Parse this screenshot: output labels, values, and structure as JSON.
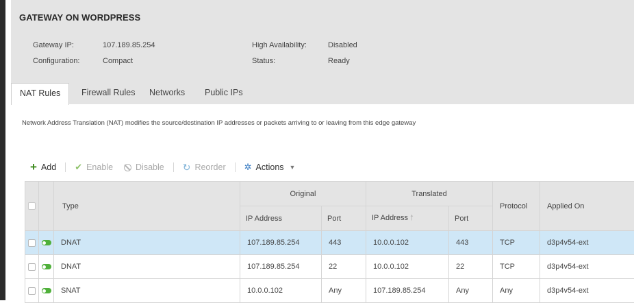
{
  "header": {
    "title": "GATEWAY ON WORDPRESS",
    "gateway_ip_label": "Gateway IP:",
    "gateway_ip_value": "107.189.85.254",
    "configuration_label": "Configuration:",
    "configuration_value": "Compact",
    "ha_label": "High Availability:",
    "ha_value": "Disabled",
    "status_label": "Status:",
    "status_value": "Ready"
  },
  "tabs": [
    {
      "label": "NAT Rules",
      "active": true
    },
    {
      "label": "Firewall Rules",
      "active": false
    },
    {
      "label": "Networks",
      "active": false
    },
    {
      "label": "Public IPs",
      "active": false
    }
  ],
  "description": "Network Address Translation (NAT) modifies the source/destination IP addresses or packets arriving to or leaving from this edge gateway",
  "toolbar": {
    "add": "Add",
    "enable": "Enable",
    "disable": "Disable",
    "reorder": "Reorder",
    "actions": "Actions"
  },
  "table": {
    "col_type": "Type",
    "group_original": "Original",
    "group_translated": "Translated",
    "col_orig_ip": "IP Address",
    "col_orig_port": "Port",
    "col_trans_ip": "IP Address",
    "col_trans_port": "Port",
    "col_protocol": "Protocol",
    "col_applied": "Applied On",
    "rows": [
      {
        "type": "DNAT",
        "orig_ip": "107.189.85.254",
        "orig_port": "443",
        "trans_ip": "10.0.0.102",
        "trans_port": "443",
        "protocol": "TCP",
        "applied": "d3p4v54-ext",
        "selected": true,
        "enabled": true
      },
      {
        "type": "DNAT",
        "orig_ip": "107.189.85.254",
        "orig_port": "22",
        "trans_ip": "10.0.0.102",
        "trans_port": "22",
        "protocol": "TCP",
        "applied": "d3p4v54-ext",
        "selected": false,
        "enabled": true
      },
      {
        "type": "SNAT",
        "orig_ip": "10.0.0.102",
        "orig_port": "Any",
        "trans_ip": "107.189.85.254",
        "trans_port": "Any",
        "protocol": "Any",
        "applied": "d3p4v54-ext",
        "selected": false,
        "enabled": true
      }
    ]
  },
  "colors": {
    "header_bg": "#e4e4e4",
    "selected_row": "#cfe7f7",
    "toggle_on": "#4fb03a",
    "add_green": "#3c8a1e",
    "accent_blue": "#3d7fc4"
  }
}
